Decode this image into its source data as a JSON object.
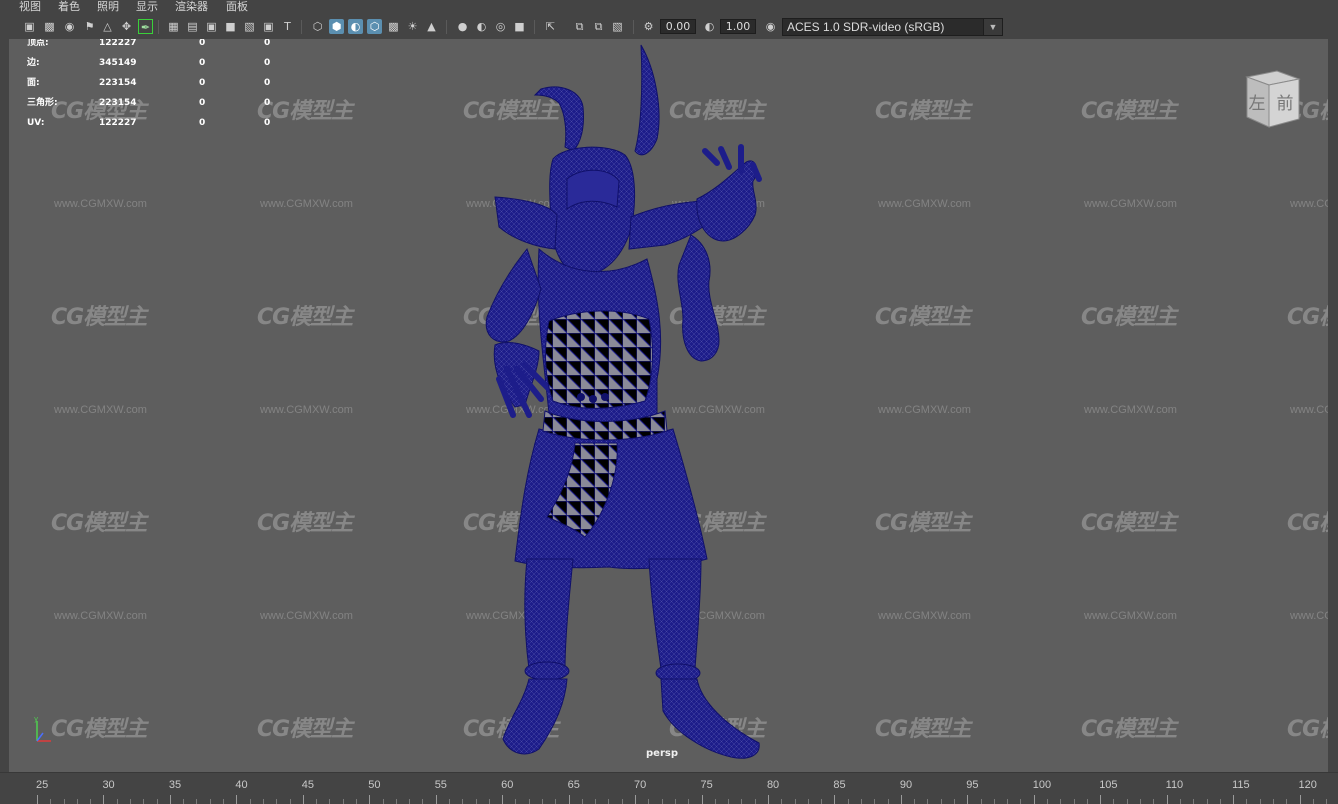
{
  "menu": [
    "视图",
    "着色",
    "照明",
    "显示",
    "渲染器",
    "面板"
  ],
  "toolbar": {
    "icons": [
      "camera-select-icon",
      "camera-lock-icon",
      "camera-attributes-icon",
      "bookmark-icon",
      "image-plane-icon",
      "2d-pan-zoom-icon",
      "grease-pencil-icon",
      "grid-icon",
      "film-gate-icon",
      "resolution-gate-icon",
      "gate-mask-icon",
      "field-chart-icon",
      "safe-action-icon",
      "safe-title-icon",
      "wireframe-icon",
      "smooth-shade-icon",
      "wireframe-on-shaded-icon",
      "flat-shade-icon",
      "textured-icon",
      "lighting-icon",
      "shadows-icon",
      "screen-space-ao-icon",
      "motion-blur-icon",
      "anti-aliasing-icon",
      "depth-of-field-icon",
      "isolate-select-icon",
      "xray-icon",
      "xray-joints-icon",
      "backface-culling-icon",
      "exposure-icon",
      "gamma-icon",
      "color-management-icon"
    ],
    "exposure": "0.00",
    "gamma": "1.00",
    "color_space": "ACES 1.0 SDR-video (sRGB)"
  },
  "hud": {
    "rows": [
      {
        "label": "顶点:",
        "c1": "122227",
        "c2": "0",
        "c3": "0"
      },
      {
        "label": "边:",
        "c1": "345149",
        "c2": "0",
        "c3": "0"
      },
      {
        "label": "面:",
        "c1": "223154",
        "c2": "0",
        "c3": "0"
      },
      {
        "label": "三角形:",
        "c1": "223154",
        "c2": "0",
        "c3": "0"
      },
      {
        "label": "UV:",
        "c1": "122227",
        "c2": "0",
        "c3": "0"
      }
    ]
  },
  "view_cube": {
    "left_face": "左",
    "front_face": "前"
  },
  "viewport": {
    "camera_label": "persp",
    "mesh_color": "#1c1c86",
    "background": "#5e5e5e"
  },
  "watermark": {
    "logo": "CG模型主",
    "url": "www.CGMXW.com"
  },
  "timeline": {
    "ticks": [
      "25",
      "30",
      "35",
      "40",
      "45",
      "50",
      "55",
      "60",
      "65",
      "70",
      "75",
      "80",
      "85",
      "90",
      "95",
      "100",
      "105",
      "110",
      "115",
      "120"
    ]
  }
}
